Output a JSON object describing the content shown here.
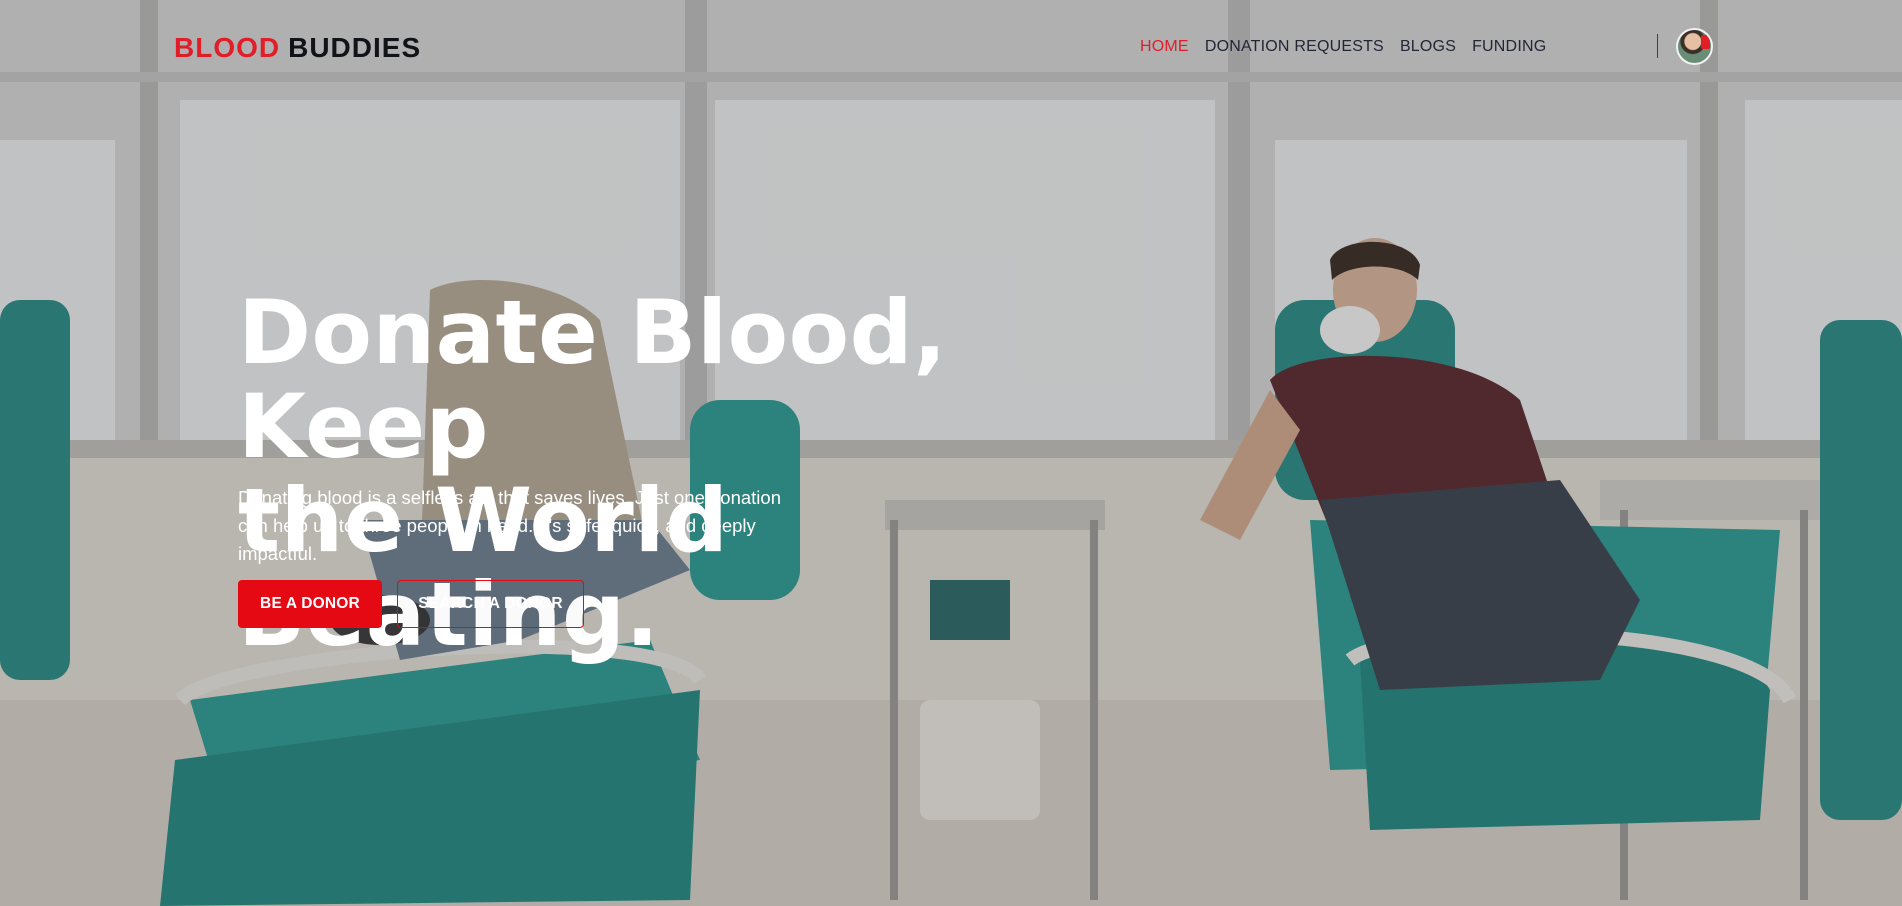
{
  "navbar": {
    "logo_part1": "BLOOD",
    "logo_part2": "BUDDIES",
    "menu": [
      {
        "label": "HOME",
        "active": true
      },
      {
        "label": "DONATION REQUESTS",
        "active": false
      },
      {
        "label": "BLOGS",
        "active": false
      },
      {
        "label": "FUNDING",
        "active": false
      }
    ],
    "avatar": "user-avatar"
  },
  "hero": {
    "headline_line1": "Donate Blood, Keep",
    "headline_line2": "the World Beating.",
    "description": "Donating blood is a selfless act that saves lives. Just one donation can help up to three people in need. It's safe, quick, and deeply impactful.",
    "primary_button": "BE A DONOR",
    "secondary_button": "SEARCH A DONOR",
    "background_image": "blood-donation-clinic-photo"
  },
  "colors": {
    "accent": "#e11d28",
    "button_red": "#e50914",
    "nav_text": "#222736",
    "hero_text": "#ffffff"
  }
}
